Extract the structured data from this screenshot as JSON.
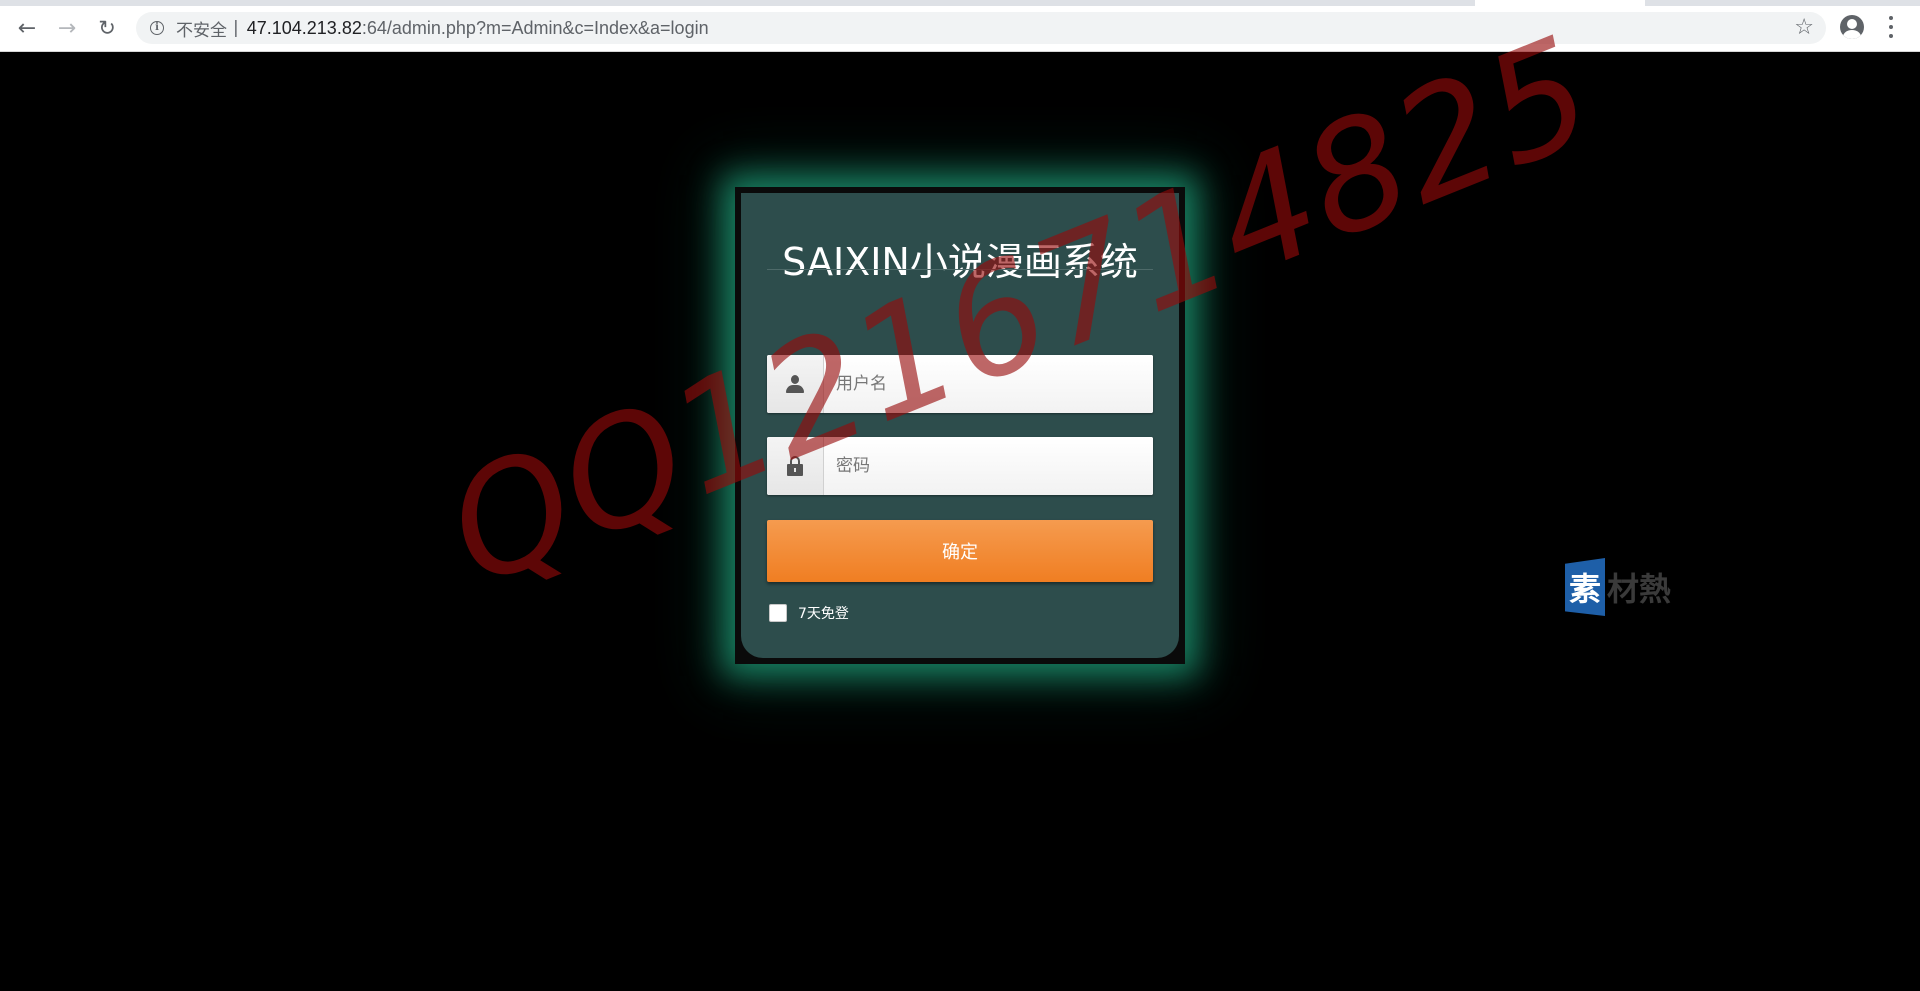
{
  "browser": {
    "security_label": "不安全",
    "separator": "|",
    "url_host": "47.104.213.82",
    "url_rest": ":64/admin.php?m=Admin&c=Index&a=login"
  },
  "login": {
    "title": "SAIXIN小说漫画系统",
    "username_placeholder": "用户名",
    "password_placeholder": "密码",
    "submit_label": "确定",
    "remember_label": "7天免登",
    "remember_checked": false
  },
  "watermark": {
    "text": "QQ1216714825"
  },
  "side_logo": {
    "badge_char": "素",
    "rest_text": "材熱"
  },
  "colors": {
    "page_background": "#000000",
    "panel_background": "#2d4d4c",
    "panel_glow": "#28d2a0",
    "submit_button": "#f07e22",
    "watermark": "#960a0a",
    "logo_badge": "#1e5fa8"
  },
  "icons": {
    "back": "back-arrow-icon",
    "forward": "forward-arrow-icon",
    "reload": "reload-icon",
    "info": "info-icon",
    "bookmark": "star-icon",
    "profile": "account-icon",
    "menu": "kebab-menu-icon",
    "username": "user-icon",
    "password": "lock-icon"
  }
}
